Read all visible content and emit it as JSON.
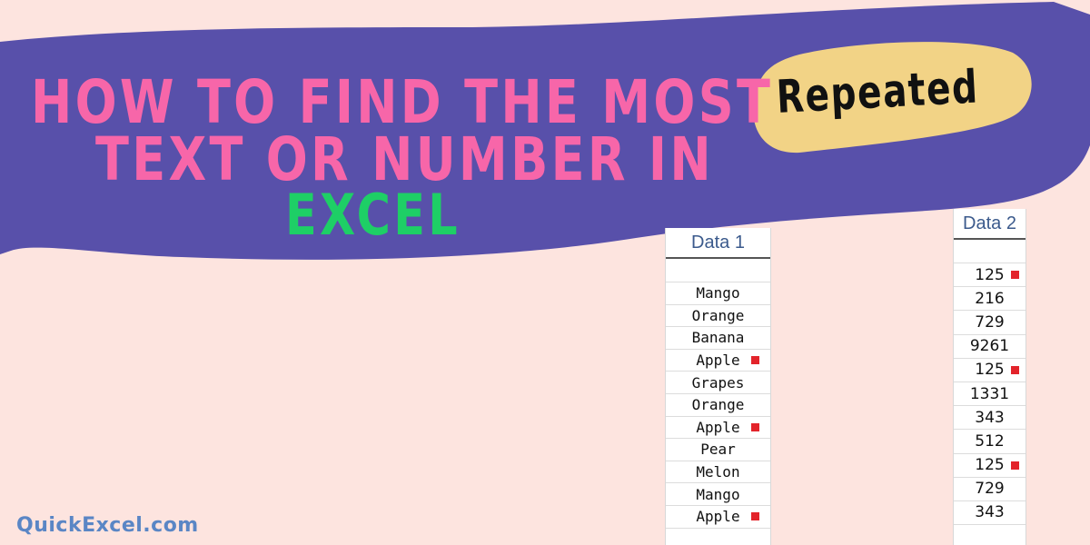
{
  "colors": {
    "background": "#fde4df",
    "banner": "#5850aa",
    "title_pink": "#f766a9",
    "title_green": "#1ecf66",
    "highlight_blob": "#f2d386",
    "highlight_text": "#111111",
    "header_text": "#3b5a8c",
    "marker": "#e3242b",
    "brand": "#5a86c5"
  },
  "title": {
    "line1": "How to find the most",
    "line2": "text or number in",
    "line3": "Excel",
    "highlight": "Repeated"
  },
  "data1": {
    "header": "Data 1",
    "rows": [
      {
        "value": "Mango",
        "marked": false
      },
      {
        "value": "Orange",
        "marked": false
      },
      {
        "value": "Banana",
        "marked": false
      },
      {
        "value": "Apple",
        "marked": true
      },
      {
        "value": "Grapes",
        "marked": false
      },
      {
        "value": "Orange",
        "marked": false
      },
      {
        "value": "Apple",
        "marked": true
      },
      {
        "value": "Pear",
        "marked": false
      },
      {
        "value": "Melon",
        "marked": false
      },
      {
        "value": "Mango",
        "marked": false
      },
      {
        "value": "Apple",
        "marked": true
      }
    ]
  },
  "data2": {
    "header": "Data 2",
    "rows": [
      {
        "value": "125",
        "marked": true
      },
      {
        "value": "216",
        "marked": false
      },
      {
        "value": "729",
        "marked": false
      },
      {
        "value": "9261",
        "marked": false
      },
      {
        "value": "125",
        "marked": true
      },
      {
        "value": "1331",
        "marked": false
      },
      {
        "value": "343",
        "marked": false
      },
      {
        "value": "512",
        "marked": false
      },
      {
        "value": "125",
        "marked": true
      },
      {
        "value": "729",
        "marked": false
      },
      {
        "value": "343",
        "marked": false
      }
    ]
  },
  "footer": {
    "brand": "QuickExcel.com"
  }
}
